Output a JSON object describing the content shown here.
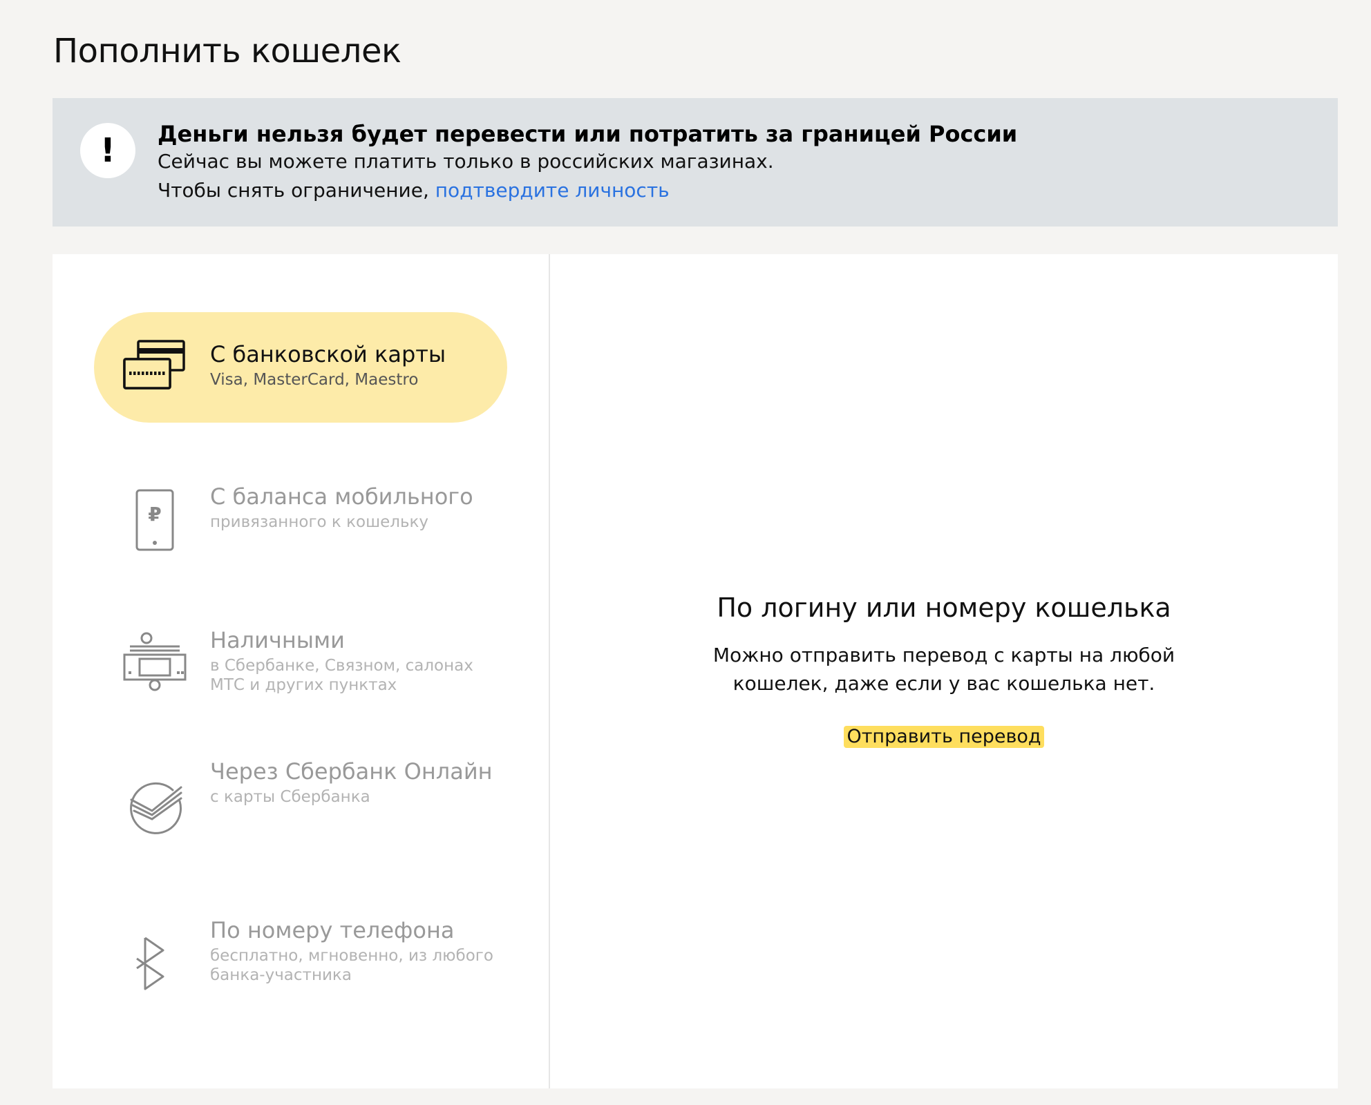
{
  "page": {
    "title": "Пополнить кошелек"
  },
  "notice": {
    "icon": "exclamation-icon",
    "icon_glyph": "!",
    "title": "Деньги нельзя будет перевести или потратить за границей России",
    "line1": "Сейчас вы можете платить только в российских магазинах.",
    "line2_prefix": "Чтобы снять ограничение, ",
    "line2_link": "подтвердите личность",
    "link_color": "#2a72e0"
  },
  "methods": [
    {
      "icon": "bank-cards-icon",
      "title": "С банковской карты",
      "subtitle": "Visa, MasterCard, Maestro",
      "active": true
    },
    {
      "icon": "mobile-phone-ruble-icon",
      "title": "С баланса мобильного",
      "subtitle": "привязанного к кошельку",
      "active": false
    },
    {
      "icon": "cash-terminal-icon",
      "title": "Наличными",
      "subtitle": "в Сбербанке, Связном, салонах МТС и других пунктах",
      "active": false
    },
    {
      "icon": "sberbank-logo-icon",
      "title": "Через Сбербанк Онлайн",
      "subtitle": "с карты Сбербанка",
      "active": false
    },
    {
      "icon": "sbp-logo-icon",
      "title": "По номеру телефона",
      "subtitle": "бесплатно, мгновенно, из любого банка-участника",
      "active": false
    }
  ],
  "detail": {
    "title": "По логину или номеру кошелька",
    "description_line1": "Можно отправить перевод с карты на любой",
    "description_line2": "кошелек, даже если у вас кошелька нет.",
    "send_button": "Отправить перевод"
  },
  "colors": {
    "background": "#f5f4f2",
    "notice_background": "#dee2e5",
    "active_method": "#fdeba9",
    "button_yellow": "#fede5e"
  }
}
